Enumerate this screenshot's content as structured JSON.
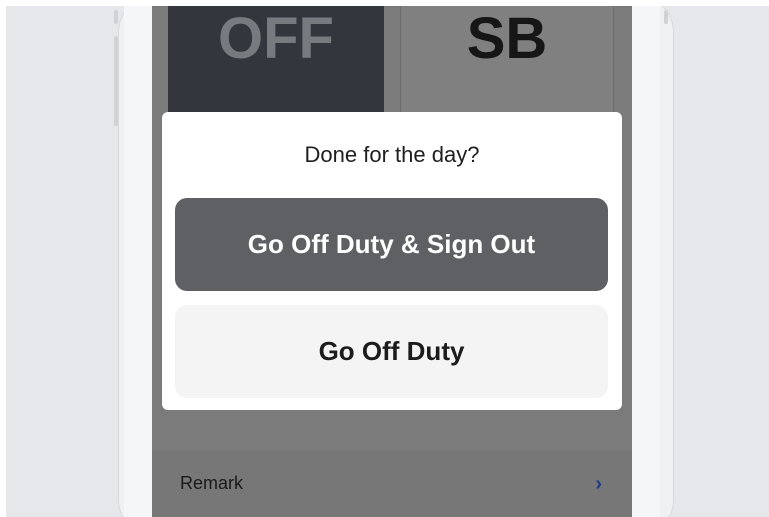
{
  "status_tiles": {
    "off": "OFF",
    "sb": "SB"
  },
  "dialog": {
    "title": "Done for the day?",
    "primary_button": "Go Off Duty & Sign Out",
    "secondary_button": "Go Off Duty"
  },
  "remark": {
    "label": "Remark",
    "chevron": "›"
  },
  "colors": {
    "primary_button_bg": "#5f6063",
    "secondary_button_bg": "#f4f4f4",
    "chevron": "#1d3a80",
    "overlay": "#7b7b7b"
  },
  "icons": {
    "chevron": "chevron-right-icon"
  }
}
